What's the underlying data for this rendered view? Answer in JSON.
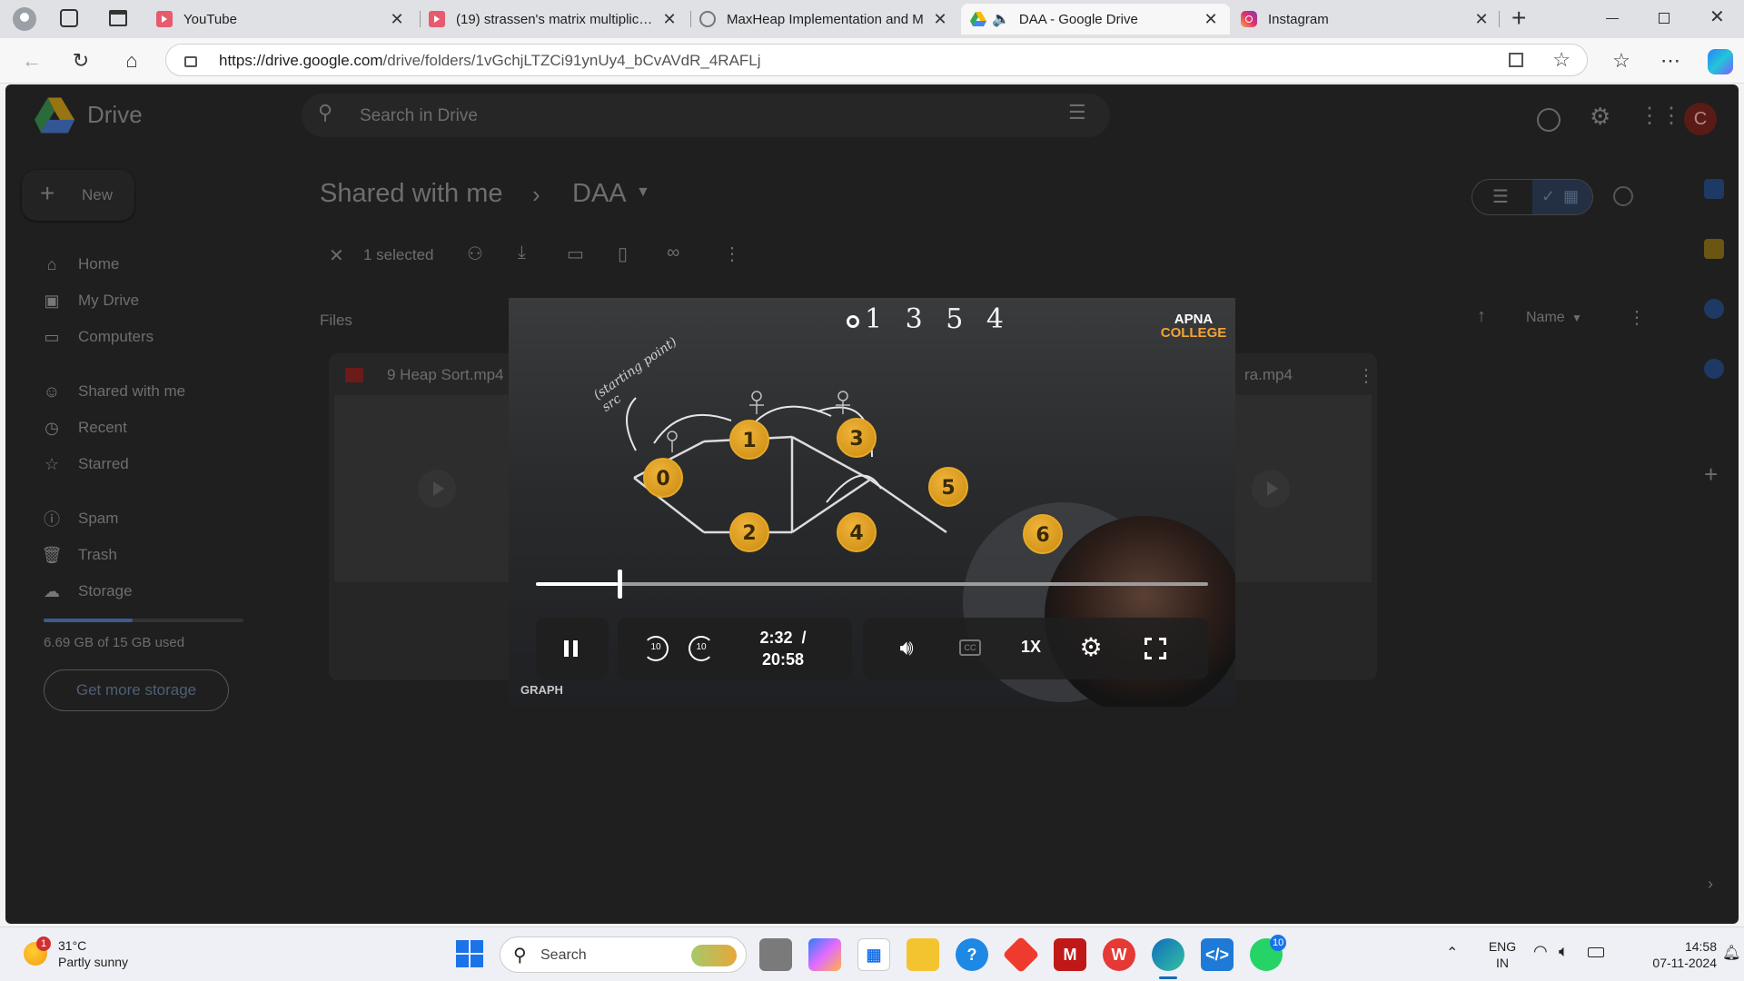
{
  "browser": {
    "tabs": [
      {
        "title": "YouTube",
        "favicon": "youtube-icon",
        "active": false
      },
      {
        "title": "(19) strassen's matrix multiplicatio",
        "favicon": "youtube-icon",
        "active": false
      },
      {
        "title": "MaxHeap Implementation and M",
        "favicon": "openai-icon",
        "active": false
      },
      {
        "title": "DAA - Google Drive",
        "favicon": "drive-icon",
        "active": true
      },
      {
        "title": "Instagram",
        "favicon": "instagram-icon",
        "active": false
      }
    ],
    "url_domain": "https://drive.google.com",
    "url_path": "/drive/folders/1vGchjLTZCi91ynUy4_bCvAVdR_4RAFLj"
  },
  "drive": {
    "app_name": "Drive",
    "search_placeholder": "Search in Drive",
    "avatar_letter": "C",
    "new_label": "New",
    "sidebar": [
      {
        "label": "Home",
        "icon": "home-icon"
      },
      {
        "label": "My Drive",
        "icon": "drive-folder-icon"
      },
      {
        "label": "Computers",
        "icon": "computer-icon"
      },
      {
        "label": "Shared with me",
        "icon": "people-icon"
      },
      {
        "label": "Recent",
        "icon": "clock-icon"
      },
      {
        "label": "Starred",
        "icon": "star-icon"
      },
      {
        "label": "Spam",
        "icon": "spam-icon"
      },
      {
        "label": "Trash",
        "icon": "trash-icon"
      },
      {
        "label": "Storage",
        "icon": "cloud-icon"
      }
    ],
    "storage_used": "6.69 GB of 15 GB used",
    "storage_fraction": 0.446,
    "get_storage_label": "Get more storage",
    "breadcrumb": {
      "parent": "Shared with me",
      "current": "DAA"
    },
    "selection_label": "1 selected",
    "files_heading": "Files",
    "sort_label": "Name",
    "file_left": "9 Heap Sort.mp4",
    "file_right_suffix": "ra.mp4"
  },
  "player": {
    "board_text": "1 3 5 4",
    "brand_line1": "APNA",
    "brand_line2": "COLLEGE",
    "annotation": "(starting point) src",
    "nodes": [
      "0",
      "1",
      "2",
      "3",
      "4",
      "5",
      "6"
    ],
    "current_time": "2:32",
    "separator": "/",
    "total_time": "20:58",
    "progress_fraction": 0.121,
    "speed_label": "1X",
    "cc_label": "CC",
    "chapter_label": "GRAPH"
  },
  "taskbar": {
    "weather_temp": "31°C",
    "weather_desc": "Partly sunny",
    "weather_badge": "1",
    "search_placeholder": "Search",
    "whatsapp_badge": "10",
    "lang_line1": "ENG",
    "lang_line2": "IN",
    "time": "14:58",
    "date": "07-11-2024"
  }
}
